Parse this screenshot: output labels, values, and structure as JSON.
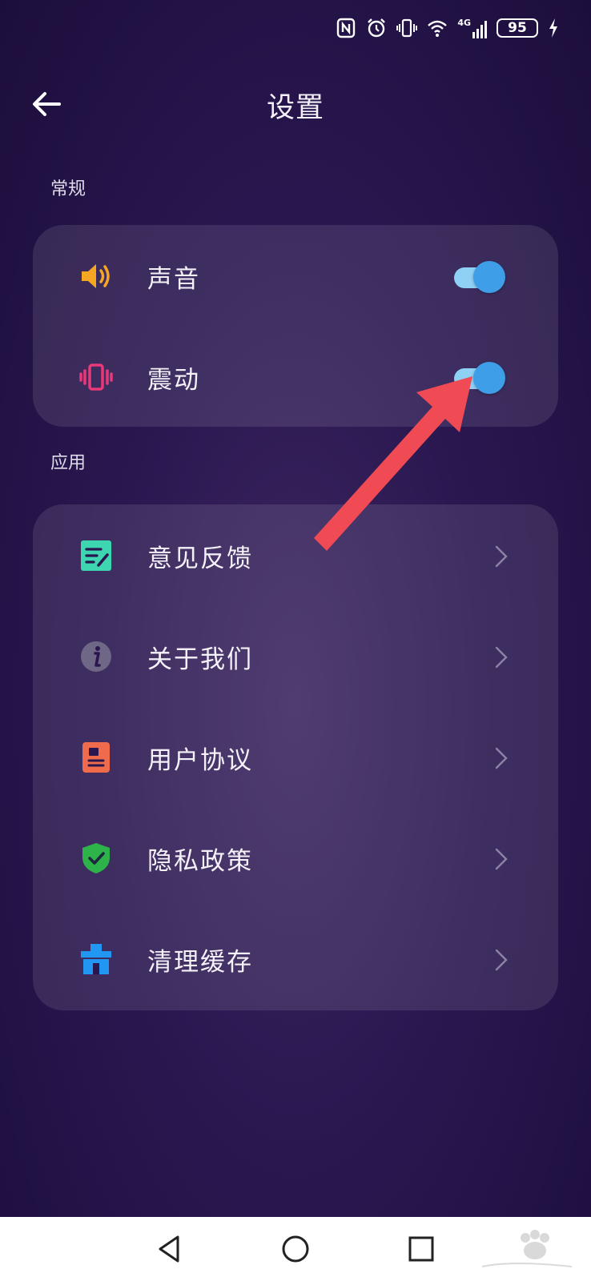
{
  "status_bar": {
    "icons": [
      "nfc-icon",
      "alarm-icon",
      "vibrate-icon",
      "wifi-icon",
      "signal-4g-icon",
      "charging-icon"
    ],
    "network": "4G",
    "battery": "95"
  },
  "header": {
    "title": "设置",
    "back_icon": "arrow-left-icon"
  },
  "sections": {
    "general": {
      "title": "常规",
      "items": [
        {
          "label": "声音",
          "icon": "speaker-icon",
          "toggle_on": true
        },
        {
          "label": "震动",
          "icon": "vibrate-icon",
          "toggle_on": true
        }
      ]
    },
    "apps": {
      "title": "应用",
      "items": [
        {
          "label": "意见反馈",
          "icon": "feedback-icon"
        },
        {
          "label": "关于我们",
          "icon": "info-icon"
        },
        {
          "label": "用户协议",
          "icon": "agreement-icon"
        },
        {
          "label": "隐私政策",
          "icon": "shield-check-icon"
        },
        {
          "label": "清理缓存",
          "icon": "toolbox-icon"
        }
      ]
    }
  },
  "colors": {
    "accent": "#3f9ee8",
    "toggle_track": "#8fd0f5",
    "annotation_arrow": "#f04a55"
  },
  "nav_bar": {
    "icons": [
      "back-triangle-icon",
      "home-circle-icon",
      "recents-square-icon"
    ]
  }
}
